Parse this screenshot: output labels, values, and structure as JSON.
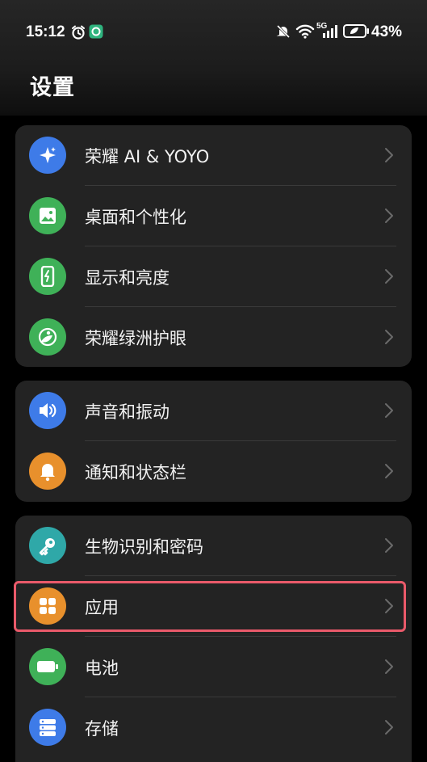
{
  "status_bar": {
    "time": "15:12",
    "network": "5G",
    "battery_percent": "43%"
  },
  "header": {
    "title": "设置"
  },
  "groups": [
    {
      "items": [
        {
          "label": "荣耀 AI & YOYO",
          "icon": "sparkle-icon",
          "color": "#3e7be8"
        },
        {
          "label": "桌面和个性化",
          "icon": "image-icon",
          "color": "#3fb158"
        },
        {
          "label": "显示和亮度",
          "icon": "phone-brightness-icon",
          "color": "#3fb158"
        },
        {
          "label": "荣耀绿洲护眼",
          "icon": "eye-care-icon",
          "color": "#3fb158"
        }
      ]
    },
    {
      "items": [
        {
          "label": "声音和振动",
          "icon": "speaker-icon",
          "color": "#3e7be8"
        },
        {
          "label": "通知和状态栏",
          "icon": "bell-icon",
          "color": "#e8902c"
        }
      ]
    },
    {
      "items": [
        {
          "label": "生物识别和密码",
          "icon": "key-icon",
          "color": "#2fa8a8"
        },
        {
          "label": "应用",
          "icon": "apps-grid-icon",
          "color": "#e8902c"
        },
        {
          "label": "电池",
          "icon": "battery-icon",
          "color": "#3fb158"
        },
        {
          "label": "存储",
          "icon": "storage-icon",
          "color": "#3e7be8"
        }
      ]
    }
  ]
}
